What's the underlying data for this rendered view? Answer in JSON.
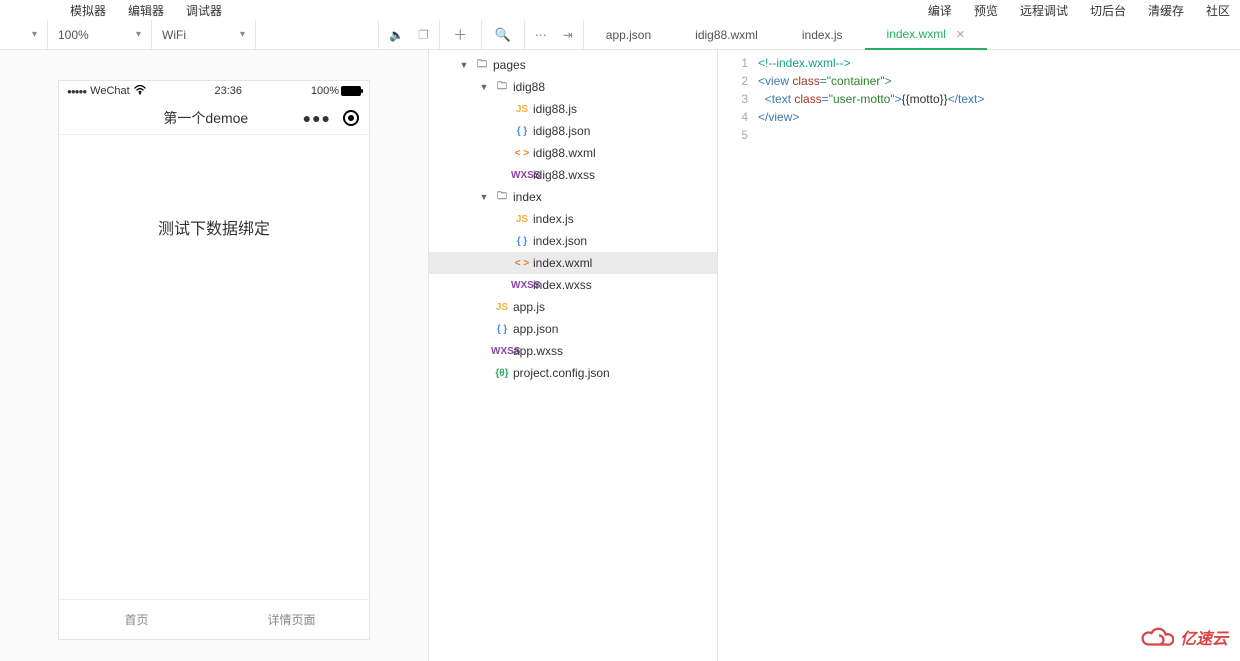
{
  "top_menu": {
    "left": [
      "模拟器",
      "编辑器",
      "调试器"
    ],
    "right": [
      "编译",
      "预览",
      "远程调试",
      "切后台",
      "清缓存",
      "社区"
    ]
  },
  "toolbar": {
    "zoom": "100%",
    "network": "WiFi"
  },
  "simulator": {
    "carrier": "WeChat",
    "time": "23:36",
    "battery": "100%",
    "page_title": "第一个demoe",
    "body_text": "测试下数据绑定",
    "tabs": [
      "首页",
      "详情页面"
    ]
  },
  "tree": [
    {
      "depth": 1,
      "chev": "▼",
      "icon": "folder",
      "label": "pages"
    },
    {
      "depth": 2,
      "chev": "▼",
      "icon": "folder",
      "label": "idig88"
    },
    {
      "depth": 3,
      "chev": "",
      "icon": "js",
      "label": "idig88.js"
    },
    {
      "depth": 3,
      "chev": "",
      "icon": "json",
      "label": "idig88.json"
    },
    {
      "depth": 3,
      "chev": "",
      "icon": "wxml",
      "label": "idig88.wxml"
    },
    {
      "depth": 3,
      "chev": "",
      "icon": "wxss",
      "label": "idig88.wxss"
    },
    {
      "depth": 2,
      "chev": "▼",
      "icon": "folder",
      "label": "index"
    },
    {
      "depth": 3,
      "chev": "",
      "icon": "js",
      "label": "index.js"
    },
    {
      "depth": 3,
      "chev": "",
      "icon": "json",
      "label": "index.json"
    },
    {
      "depth": 3,
      "chev": "",
      "icon": "wxml",
      "label": "index.wxml",
      "active": true
    },
    {
      "depth": 3,
      "chev": "",
      "icon": "wxss",
      "label": "index.wxss"
    },
    {
      "depth": 2,
      "chev": "",
      "icon": "js",
      "label": "app.js"
    },
    {
      "depth": 2,
      "chev": "",
      "icon": "json",
      "label": "app.json"
    },
    {
      "depth": 2,
      "chev": "",
      "icon": "wxss",
      "label": "app.wxss"
    },
    {
      "depth": 2,
      "chev": "",
      "icon": "config",
      "label": "project.config.json"
    }
  ],
  "editor_tabs": [
    {
      "label": "app.json",
      "active": false,
      "closable": false
    },
    {
      "label": "idig88.wxml",
      "active": false,
      "closable": false
    },
    {
      "label": "index.js",
      "active": false,
      "closable": false
    },
    {
      "label": "index.wxml",
      "active": true,
      "closable": true
    }
  ],
  "code": {
    "lines": [
      "1",
      "2",
      "3",
      "4",
      "5"
    ],
    "line1_comment": "<!--index.wxml-->",
    "line2": {
      "open": "<",
      "tag": "view ",
      "attr": "class",
      "eq": "=",
      "val": "\"container\"",
      "close": ">"
    },
    "line3": {
      "indent": "  ",
      "open": "<",
      "tag": "text ",
      "attr": "class",
      "eq": "=",
      "val": "\"user-motto\"",
      "close": ">",
      "body": "{{motto}}",
      "copen": "</",
      "ctag": "text",
      "cclose": ">"
    },
    "line4": {
      "copen": "</",
      "ctag": "view",
      "cclose": ">"
    }
  },
  "watermark": "亿速云"
}
